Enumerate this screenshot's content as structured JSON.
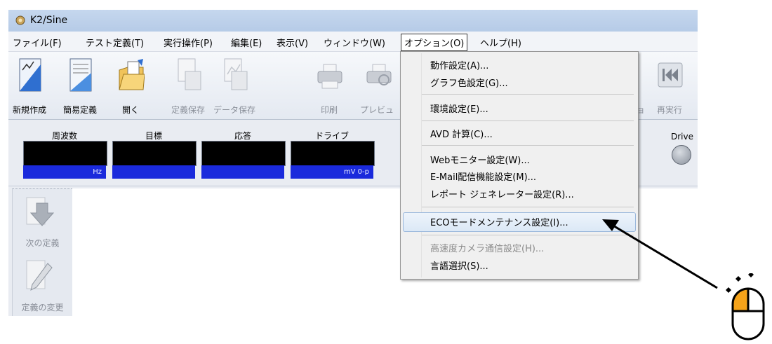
{
  "window": {
    "title": "K2/Sine"
  },
  "menubar": {
    "items": [
      "ファイル(F)",
      "テスト定義(T)",
      "実行操作(P)",
      "編集(E)",
      "表示(V)",
      "ウィンドウ(W)",
      "オプション(O)",
      "ヘルプ(H)"
    ],
    "active_index": 6
  },
  "toolbar": {
    "new": "新規作成",
    "simple_def": "簡易定義",
    "open": "開く",
    "save_def": "定義保存",
    "save_data": "データ保存",
    "print": "印刷",
    "preview": "プレビュ",
    "hidden_right": "ョ",
    "rerun": "再実行"
  },
  "meters": {
    "labels": [
      "周波数",
      "目標",
      "応答",
      "ドライブ"
    ],
    "units": [
      "Hz",
      "",
      "",
      "mV 0-p"
    ],
    "drive_label": "Drive"
  },
  "side": {
    "next_def": "次の定義",
    "change_def": "定義の変更"
  },
  "options_menu": {
    "items": [
      "動作設定(A)...",
      "グラフ色設定(G)...",
      "環境設定(E)...",
      "AVD 計算(C)...",
      "Webモニター設定(W)...",
      "E-Mail配信機能設定(M)...",
      "レポート ジェネレーター設定(R)...",
      "ECOモードメンテナンス設定(I)...",
      "高速度カメラ通信設定(H)...",
      "言語選択(S)..."
    ],
    "highlighted_index": 7,
    "disabled_index": 8
  },
  "colors": {
    "accent_mouse": "#f5a31a",
    "meter_unit_bar": "#1a2adc"
  }
}
